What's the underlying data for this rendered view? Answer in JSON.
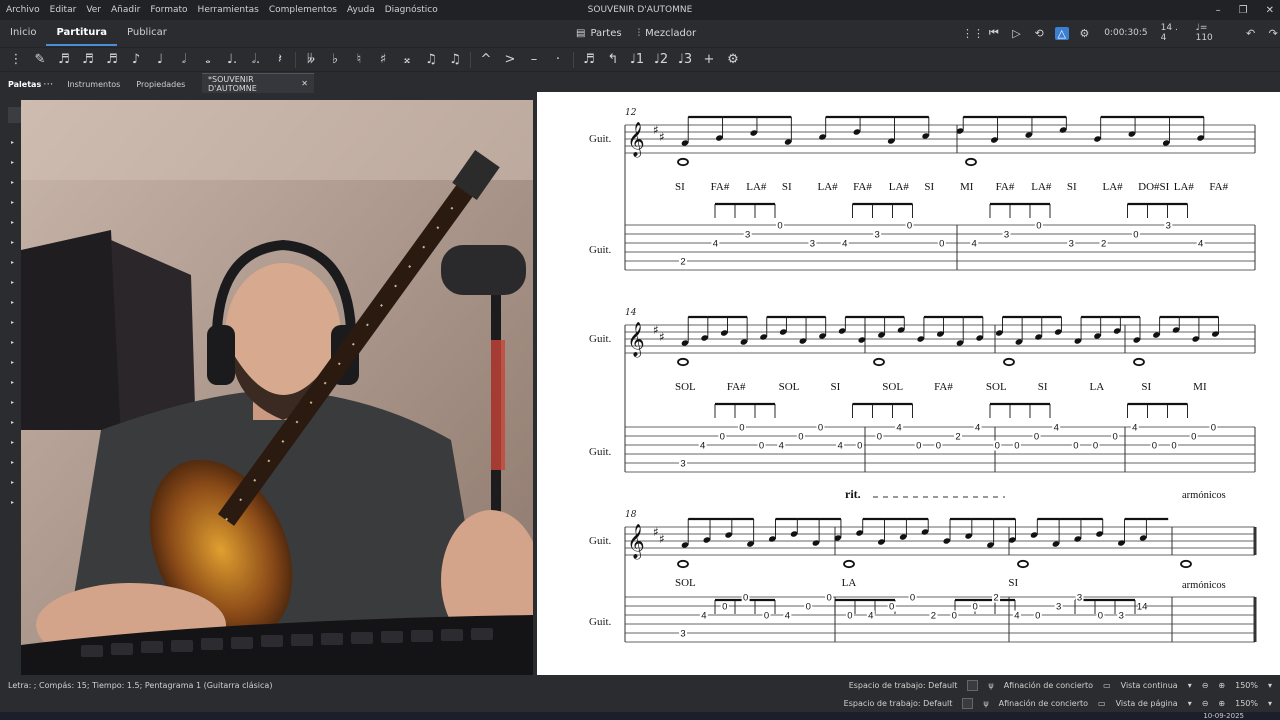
{
  "menu": [
    "Archivo",
    "Editar",
    "Ver",
    "Añadir",
    "Formato",
    "Herramientas",
    "Complementos",
    "Ayuda",
    "Diagnóstico"
  ],
  "window": {
    "title": "SOUVENIR D'AUTOMNE",
    "minimize": "–",
    "maximize": "❐",
    "close": "✕"
  },
  "tabs": [
    "Inicio",
    "Partitura",
    "Publicar"
  ],
  "center_tools": {
    "parts": "Partes",
    "mixer": "Mezclador"
  },
  "playback": {
    "time": "0:00:30:5",
    "position": "14 . 4",
    "tempo": "♩= 110"
  },
  "panel_tabs": {
    "palettes": "Paletas",
    "instruments": "Instrumentos",
    "properties": "Propiedades",
    "more": "⋯"
  },
  "document_tab": {
    "label": "*SOUVENIR D'AUTOMNE",
    "close": "✕"
  },
  "score": {
    "instrument": "Guit.",
    "measure_numbers": [
      "12",
      "14",
      "18"
    ],
    "lyrics_row1": [
      "SI",
      "FA#",
      "LA#",
      "SI",
      "LA#",
      "FA#",
      "LA#",
      "SI",
      "MI",
      "FA#",
      "LA#",
      "SI",
      "LA#",
      "DO#SI",
      "LA#",
      "FA#"
    ],
    "lyrics_row2": [
      "SOL",
      "FA#",
      "SOL",
      "SI",
      "SOL",
      "FA#",
      "SOL",
      "SI",
      "LA",
      "SI",
      "MI"
    ],
    "lyrics_row3": [
      "SOL",
      "LA",
      "SI"
    ],
    "rit": "rit.",
    "harmonics": "armónicos",
    "tab_row1": [
      "2",
      "4",
      "3",
      "0",
      "3",
      "4",
      "3",
      "0",
      "0",
      "4",
      "3",
      "0",
      "3",
      "2",
      "0",
      "3",
      "4"
    ],
    "tab_row2": [
      "3",
      "4",
      "0",
      "0",
      "0",
      "4",
      "0",
      "0",
      "4",
      "0",
      "0",
      "4",
      "0",
      "0",
      "2",
      "4",
      "0",
      "0",
      "0",
      "4",
      "0",
      "0",
      "0",
      "4",
      "0",
      "0",
      "0",
      "0"
    ],
    "tab_row3": [
      "3",
      "4",
      "0",
      "0",
      "0",
      "4",
      "0",
      "0",
      "0",
      "4",
      "0",
      "0",
      "2",
      "0",
      "0",
      "2",
      "4",
      "0",
      "3",
      "3",
      "0",
      "3",
      "14"
    ]
  },
  "status": {
    "text": "Letra: ; Compás: 15; Tiempo: 1.5; Pentagrama 1 (Guitarra clásica)",
    "workspace": "Espacio de trabajo: Default",
    "concert_pitch": "Afinación de concierto",
    "view_continuous": "Vista continua",
    "view_page": "Vista de página",
    "zoom": "150%",
    "date": "10-09-2025"
  },
  "colors": {
    "accent": "#3b7fd1",
    "chrome": "#2b2c30",
    "score_bg": "#ffffff"
  }
}
